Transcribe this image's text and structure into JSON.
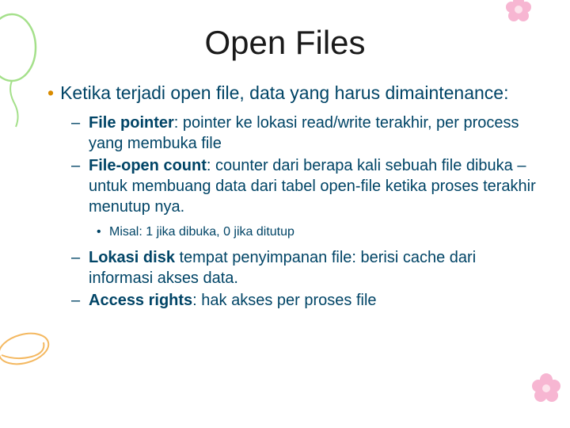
{
  "title": "Open Files",
  "main_bullet": "Ketika terjadi open file, data yang harus dimaintenance:",
  "items": {
    "i0_bold": "File pointer",
    "i0_rest": ":  pointer ke lokasi read/write terakhir, per process yang membuka file",
    "i1_bold": "File-open count",
    "i1_rest": ": counter dari berapa kali sebuah file dibuka – untuk membuang data dari tabel open-file ketika proses terakhir menutup nya.",
    "i1_sub": "Misal: 1 jika dibuka, 0 jika ditutup",
    "i2_bold": "Lokasi disk",
    "i2_rest": " tempat penyimpanan file: berisi cache dari informasi akses data.",
    "i3_bold": "Access rights",
    "i3_rest": ": hak akses per proses file"
  }
}
